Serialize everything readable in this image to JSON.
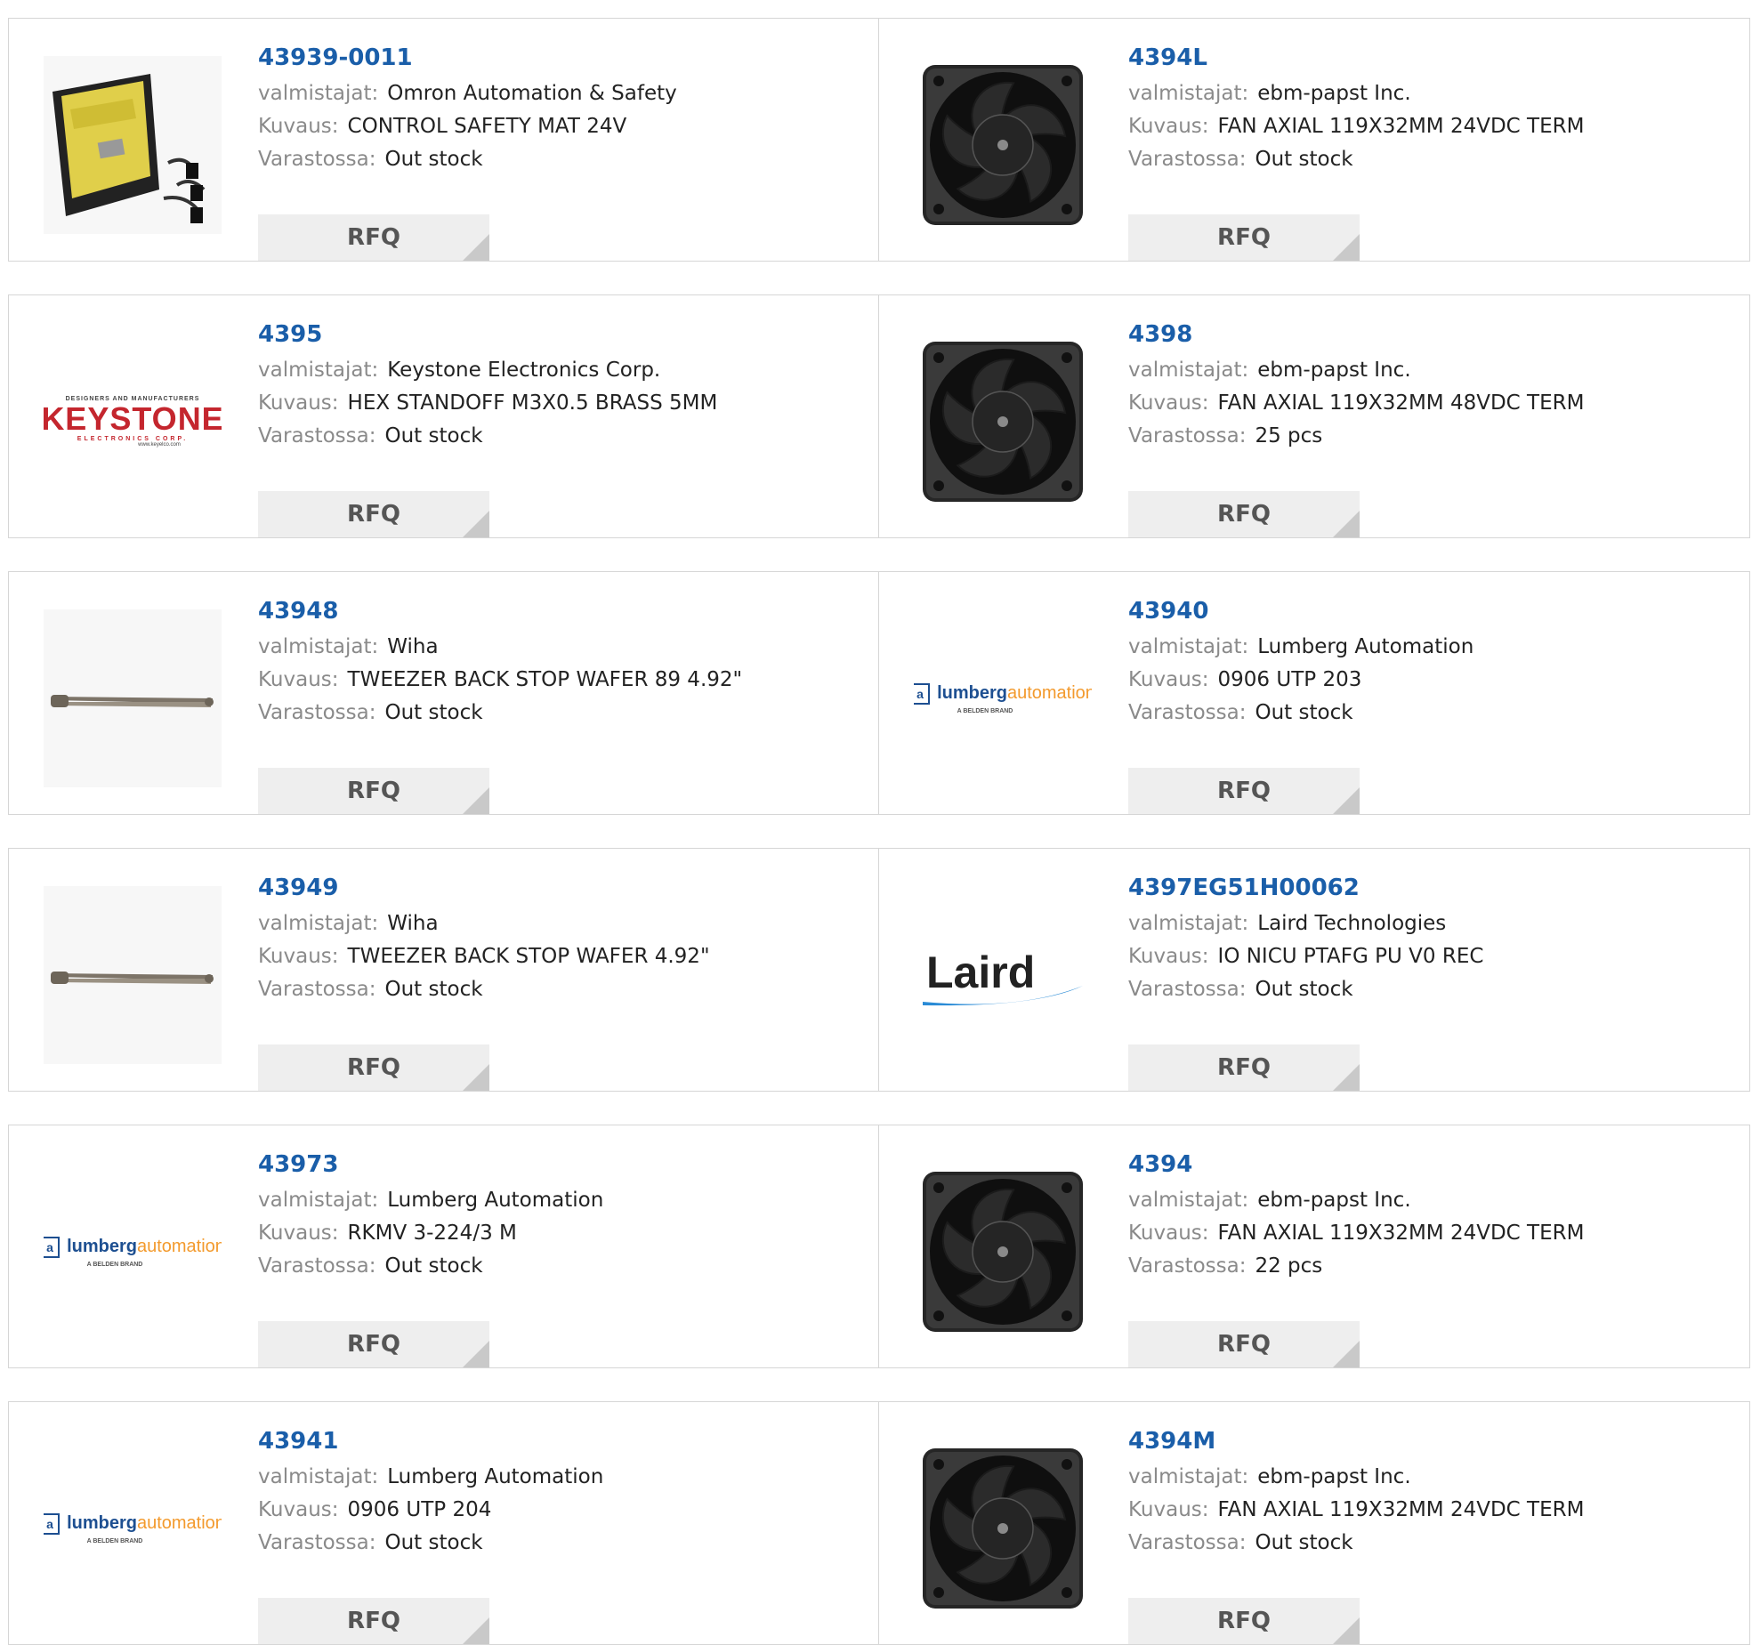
{
  "labels": {
    "manufacturer": "valmistajat:",
    "description": "Kuvaus:",
    "stock": "Varastossa:",
    "rfq": "RFQ"
  },
  "rows": [
    [
      {
        "pn": "43939-0011",
        "mfr": "Omron Automation & Safety",
        "desc": "CONTROL SAFETY MAT 24V",
        "stock": "Out stock",
        "image": "controller"
      },
      {
        "pn": "4394L",
        "mfr": "ebm-papst Inc.",
        "desc": "FAN AXIAL 119X32MM 24VDC TERM",
        "stock": "Out stock",
        "image": "fan"
      }
    ],
    [
      {
        "pn": "4395",
        "mfr": "Keystone Electronics Corp.",
        "desc": "HEX STANDOFF M3X0.5 BRASS 5MM",
        "stock": "Out stock",
        "image": "keystone"
      },
      {
        "pn": "4398",
        "mfr": "ebm-papst Inc.",
        "desc": "FAN AXIAL 119X32MM 48VDC TERM",
        "stock": "25 pcs",
        "image": "fan"
      }
    ],
    [
      {
        "pn": "43948",
        "mfr": "Wiha",
        "desc": "TWEEZER BACK STOP WAFER 89 4.92\"",
        "stock": "Out stock",
        "image": "tweezer"
      },
      {
        "pn": "43940",
        "mfr": "Lumberg Automation",
        "desc": "0906 UTP 203",
        "stock": "Out stock",
        "image": "lumberg"
      }
    ],
    [
      {
        "pn": "43949",
        "mfr": "Wiha",
        "desc": "TWEEZER BACK STOP WAFER 4.92\"",
        "stock": "Out stock",
        "image": "tweezer"
      },
      {
        "pn": "4397EG51H00062",
        "mfr": "Laird Technologies",
        "desc": "IO NICU PTAFG PU V0 REC",
        "stock": "Out stock",
        "image": "laird"
      }
    ],
    [
      {
        "pn": "43973",
        "mfr": "Lumberg Automation",
        "desc": "RKMV 3-224/3 M",
        "stock": "Out stock",
        "image": "lumberg"
      },
      {
        "pn": "4394",
        "mfr": "ebm-papst Inc.",
        "desc": "FAN AXIAL 119X32MM 24VDC TERM",
        "stock": "22 pcs",
        "image": "fan"
      }
    ],
    [
      {
        "pn": "43941",
        "mfr": "Lumberg Automation",
        "desc": "0906 UTP 204",
        "stock": "Out stock",
        "image": "lumberg"
      },
      {
        "pn": "4394M",
        "mfr": "ebm-papst Inc.",
        "desc": "FAN AXIAL 119X32MM 24VDC TERM",
        "stock": "Out stock",
        "image": "fan"
      }
    ]
  ],
  "logos": {
    "keystone": "KEYSTONE",
    "keystone_tag": "DESIGNERS AND MANUFACTURERS",
    "keystone_sub": "ELECTRONICS CORP.",
    "keystone_url": "www.keyelco.com",
    "lumberg_mark": "a",
    "lumberg_a": "lumberg",
    "lumberg_b": "automation",
    "lumberg_sub": "A BELDEN BRAND",
    "laird": "Laird"
  },
  "colors": {
    "link": "#1a5ea9",
    "border": "#d6d6d6",
    "rfq_bg": "#eeeeee",
    "keystone_red": "#c4262e",
    "lumberg_blue": "#1d4f91",
    "lumberg_orange": "#f39a2d"
  }
}
